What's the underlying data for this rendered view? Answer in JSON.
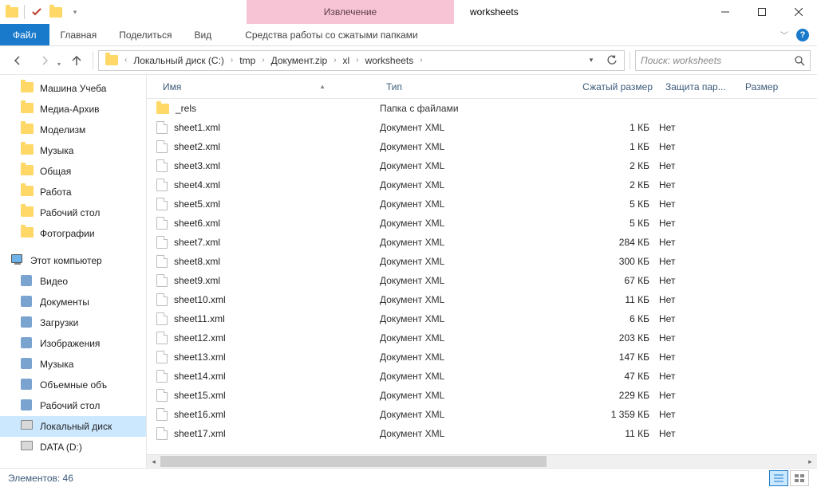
{
  "title": {
    "context_tab": "Извлечение",
    "window": "worksheets"
  },
  "ribbon": {
    "file": "Файл",
    "tabs": [
      "Главная",
      "Поделиться",
      "Вид"
    ],
    "context_tab": "Средства работы со сжатыми папками"
  },
  "breadcrumbs": [
    "Локальный диск (C:)",
    "tmp",
    "Документ.zip",
    "xl",
    "worksheets"
  ],
  "search": {
    "placeholder": "Поиск: worksheets"
  },
  "nav": {
    "quick": [
      "Машина Учеба",
      "Медиа-Архив",
      "Моделизм",
      "Музыка",
      "Общая",
      "Работа",
      "Рабочий стол",
      "Фотографии"
    ],
    "pc_label": "Этот компьютер",
    "pc_items": [
      "Видео",
      "Документы",
      "Загрузки",
      "Изображения",
      "Музыка",
      "Объемные объ",
      "Рабочий стол",
      "Локальный диск",
      "DATA (D:)"
    ]
  },
  "columns": {
    "name": "Имя",
    "type": "Тип",
    "csize": "Сжатый размер",
    "prot": "Защита пар...",
    "size": "Размер"
  },
  "rows": [
    {
      "name": "_rels",
      "type": "Папка с файлами",
      "size": "",
      "prot": "",
      "folder": true
    },
    {
      "name": "sheet1.xml",
      "type": "Документ XML",
      "size": "1 КБ",
      "prot": "Нет"
    },
    {
      "name": "sheet2.xml",
      "type": "Документ XML",
      "size": "1 КБ",
      "prot": "Нет"
    },
    {
      "name": "sheet3.xml",
      "type": "Документ XML",
      "size": "2 КБ",
      "prot": "Нет"
    },
    {
      "name": "sheet4.xml",
      "type": "Документ XML",
      "size": "2 КБ",
      "prot": "Нет"
    },
    {
      "name": "sheet5.xml",
      "type": "Документ XML",
      "size": "5 КБ",
      "prot": "Нет"
    },
    {
      "name": "sheet6.xml",
      "type": "Документ XML",
      "size": "5 КБ",
      "prot": "Нет"
    },
    {
      "name": "sheet7.xml",
      "type": "Документ XML",
      "size": "284 КБ",
      "prot": "Нет"
    },
    {
      "name": "sheet8.xml",
      "type": "Документ XML",
      "size": "300 КБ",
      "prot": "Нет"
    },
    {
      "name": "sheet9.xml",
      "type": "Документ XML",
      "size": "67 КБ",
      "prot": "Нет"
    },
    {
      "name": "sheet10.xml",
      "type": "Документ XML",
      "size": "11 КБ",
      "prot": "Нет"
    },
    {
      "name": "sheet11.xml",
      "type": "Документ XML",
      "size": "6 КБ",
      "prot": "Нет"
    },
    {
      "name": "sheet12.xml",
      "type": "Документ XML",
      "size": "203 КБ",
      "prot": "Нет"
    },
    {
      "name": "sheet13.xml",
      "type": "Документ XML",
      "size": "147 КБ",
      "prot": "Нет"
    },
    {
      "name": "sheet14.xml",
      "type": "Документ XML",
      "size": "47 КБ",
      "prot": "Нет"
    },
    {
      "name": "sheet15.xml",
      "type": "Документ XML",
      "size": "229 КБ",
      "prot": "Нет"
    },
    {
      "name": "sheet16.xml",
      "type": "Документ XML",
      "size": "1 359 КБ",
      "prot": "Нет"
    },
    {
      "name": "sheet17.xml",
      "type": "Документ XML",
      "size": "11 КБ",
      "prot": "Нет"
    }
  ],
  "status": {
    "count": "Элементов: 46"
  }
}
